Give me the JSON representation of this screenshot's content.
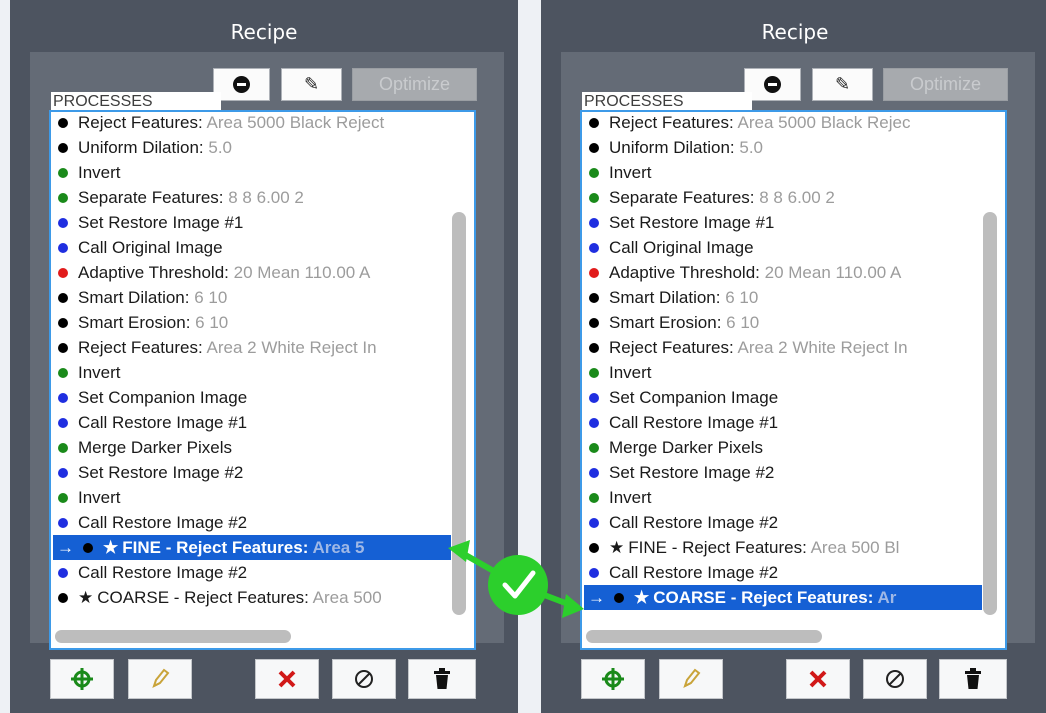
{
  "colors": {
    "black": "#000000",
    "green": "#1a8a1a",
    "blue": "#1f2ee0",
    "red": "#e11b1b",
    "selected_bg": "#1560d4",
    "params_gray": "#9c9c9c",
    "connector_green": "#2ccf2c"
  },
  "icons": {
    "toolbar_remove": "minus-circle-icon",
    "toolbar_edit": "pencil-icon",
    "target": "crosshair-icon",
    "delete": "x-icon",
    "disable": "circle-slash-icon",
    "trash": "trash-icon",
    "check": "checkmark-icon"
  },
  "panels": [
    {
      "title": "Recipe",
      "toolbar": {
        "edit_label": "✎",
        "optimize_label": "Optimize"
      },
      "processes_label": "PROCESSES",
      "items": [
        {
          "dot": "black",
          "name": "Reject Features:",
          "params": " Area 5000 Black Reject"
        },
        {
          "dot": "black",
          "name": "Uniform Dilation:",
          "params": " 5.0"
        },
        {
          "dot": "green",
          "name": "Invert",
          "params": ""
        },
        {
          "dot": "green",
          "name": "Separate Features:",
          "params": " 8 8 6.00 2"
        },
        {
          "dot": "blue",
          "name": "Set Restore Image #1",
          "params": ""
        },
        {
          "dot": "blue",
          "name": "Call Original Image",
          "params": ""
        },
        {
          "dot": "red",
          "name": "Adaptive Threshold:",
          "params": " 20 Mean 110.00 A"
        },
        {
          "dot": "black",
          "name": "Smart Dilation:",
          "params": " 6 10"
        },
        {
          "dot": "black",
          "name": "Smart Erosion:",
          "params": " 6 10"
        },
        {
          "dot": "black",
          "name": "Reject Features:",
          "params": " Area 2 White Reject In"
        },
        {
          "dot": "green",
          "name": "Invert",
          "params": ""
        },
        {
          "dot": "blue",
          "name": "Set Companion Image",
          "params": ""
        },
        {
          "dot": "blue",
          "name": "Call Restore Image #1",
          "params": ""
        },
        {
          "dot": "green",
          "name": "Merge Darker Pixels",
          "params": ""
        },
        {
          "dot": "blue",
          "name": "Set Restore Image #2",
          "params": ""
        },
        {
          "dot": "green",
          "name": "Invert",
          "params": ""
        },
        {
          "dot": "blue",
          "name": "Call Restore Image #2",
          "params": ""
        },
        {
          "dot": "black",
          "name": "FINE - Reject Features:",
          "params": " Area 5",
          "star": "★",
          "selected": true,
          "arrow": "→"
        },
        {
          "dot": "blue",
          "name": "Call Restore Image #2",
          "params": ""
        },
        {
          "dot": "black",
          "name": "COARSE - Reject Features:",
          "params": " Area 500",
          "star": "★"
        }
      ]
    },
    {
      "title": "Recipe",
      "toolbar": {
        "edit_label": "✎",
        "optimize_label": "Optimize"
      },
      "processes_label": "PROCESSES",
      "items": [
        {
          "dot": "black",
          "name": "Reject Features:",
          "params": " Area 5000 Black Rejec"
        },
        {
          "dot": "black",
          "name": "Uniform Dilation:",
          "params": " 5.0"
        },
        {
          "dot": "green",
          "name": "Invert",
          "params": ""
        },
        {
          "dot": "green",
          "name": "Separate Features:",
          "params": " 8 8 6.00 2"
        },
        {
          "dot": "blue",
          "name": "Set Restore Image #1",
          "params": ""
        },
        {
          "dot": "blue",
          "name": "Call Original Image",
          "params": ""
        },
        {
          "dot": "red",
          "name": "Adaptive Threshold:",
          "params": " 20 Mean 110.00 A"
        },
        {
          "dot": "black",
          "name": "Smart Dilation:",
          "params": " 6 10"
        },
        {
          "dot": "black",
          "name": "Smart Erosion:",
          "params": " 6 10"
        },
        {
          "dot": "black",
          "name": "Reject Features:",
          "params": " Area 2 White Reject In"
        },
        {
          "dot": "green",
          "name": "Invert",
          "params": ""
        },
        {
          "dot": "blue",
          "name": "Set Companion Image",
          "params": ""
        },
        {
          "dot": "blue",
          "name": "Call Restore Image #1",
          "params": ""
        },
        {
          "dot": "green",
          "name": "Merge Darker Pixels",
          "params": ""
        },
        {
          "dot": "blue",
          "name": "Set Restore Image #2",
          "params": ""
        },
        {
          "dot": "green",
          "name": "Invert",
          "params": ""
        },
        {
          "dot": "blue",
          "name": "Call Restore Image #2",
          "params": ""
        },
        {
          "dot": "black",
          "name": "FINE - Reject Features:",
          "params": " Area 500 Bl",
          "star": "★"
        },
        {
          "dot": "blue",
          "name": "Call Restore Image #2",
          "params": ""
        },
        {
          "dot": "black",
          "name": "COARSE - Reject Features:",
          "params": " Ar",
          "star": "★",
          "selected": true,
          "arrow": "→"
        }
      ]
    }
  ]
}
